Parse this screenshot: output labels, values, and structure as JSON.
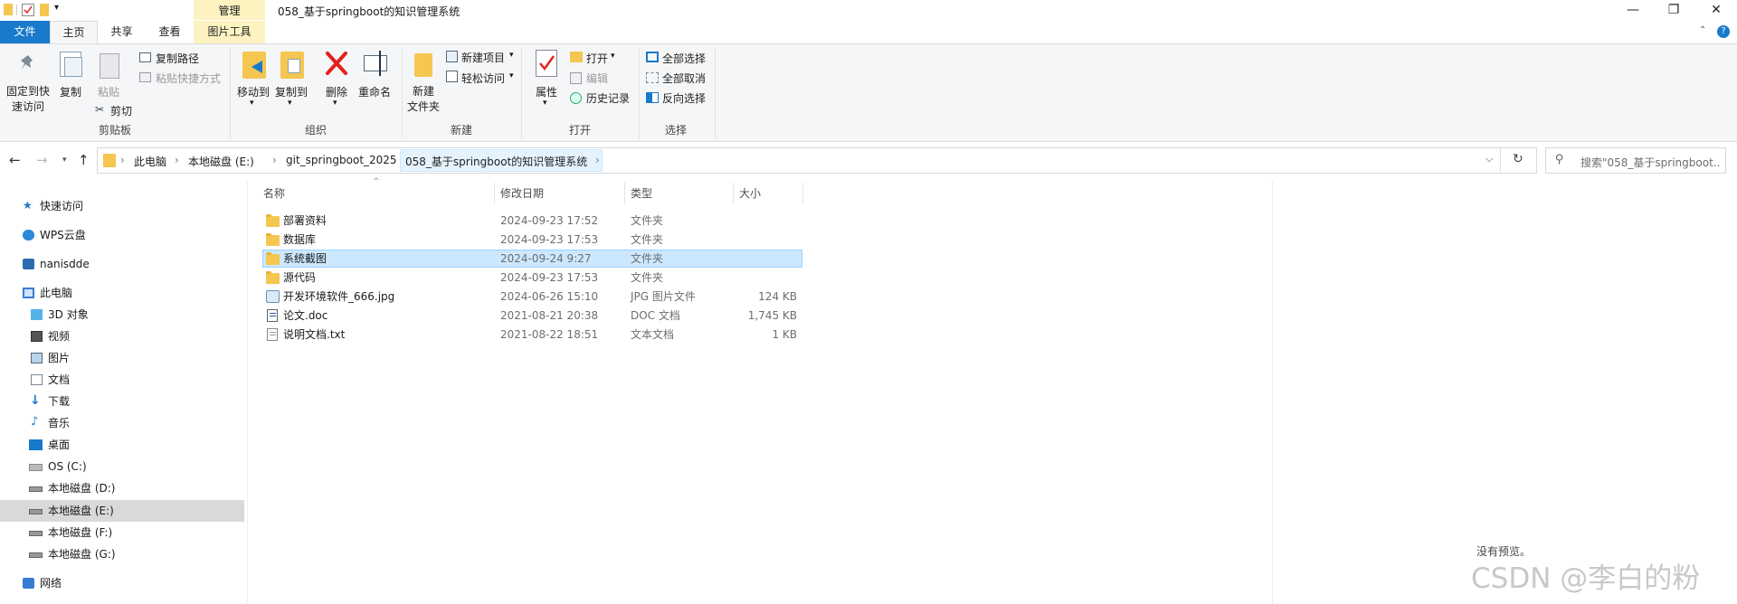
{
  "window": {
    "title": "058_基于springboot的知识管理系统",
    "context_tab_header": "管理",
    "controls": {
      "minimize": "—",
      "maximize": "❐",
      "close": "✕"
    }
  },
  "tabs": [
    "文件",
    "主页",
    "共享",
    "查看",
    "图片工具"
  ],
  "ribbon": {
    "clipboard": {
      "pin": "固定到快\n速访问",
      "copy": "复制",
      "paste": "粘贴",
      "copy_path": "复制路径",
      "paste_shortcut": "粘贴快捷方式",
      "cut": "剪切",
      "label": "剪贴板"
    },
    "organize": {
      "move_to": "移动到",
      "copy_to": "复制到",
      "delete": "删除",
      "rename": "重命名",
      "label": "组织"
    },
    "new": {
      "new_folder": "新建\n文件夹",
      "new_item": "新建项目",
      "easy_access": "轻松访问",
      "label": "新建"
    },
    "open": {
      "properties": "属性",
      "open": "打开",
      "edit": "编辑",
      "history": "历史记录",
      "label": "打开"
    },
    "select": {
      "select_all": "全部选择",
      "select_none": "全部取消",
      "invert": "反向选择",
      "label": "选择"
    }
  },
  "address": {
    "crumbs": [
      "此电脑",
      "本地磁盘 (E:)",
      "git_springboot_2025",
      "058_基于springboot的知识管理系统"
    ],
    "search_placeholder": "搜索\"058_基于springboot..."
  },
  "nav": [
    {
      "label": "快速访问",
      "icon": "star-icon",
      "level": 0
    },
    {
      "label": "WPS云盘",
      "icon": "cloud-icon",
      "level": 0
    },
    {
      "label": "nanisdde",
      "icon": "user-icon",
      "level": 0
    },
    {
      "label": "此电脑",
      "icon": "pc-icon",
      "level": 0
    },
    {
      "label": "3D 对象",
      "icon": "cube-icon",
      "level": 1
    },
    {
      "label": "视频",
      "icon": "video-icon",
      "level": 1
    },
    {
      "label": "图片",
      "icon": "picture-icon",
      "level": 1
    },
    {
      "label": "文档",
      "icon": "document-icon",
      "level": 1
    },
    {
      "label": "下载",
      "icon": "download-icon",
      "level": 1
    },
    {
      "label": "音乐",
      "icon": "music-icon",
      "level": 1
    },
    {
      "label": "桌面",
      "icon": "desktop-icon",
      "level": 1
    },
    {
      "label": "OS (C:)",
      "icon": "drive-os-icon",
      "level": 1
    },
    {
      "label": "本地磁盘 (D:)",
      "icon": "drive-icon",
      "level": 1
    },
    {
      "label": "本地磁盘 (E:)",
      "icon": "drive-icon",
      "level": 1,
      "selected": true
    },
    {
      "label": "本地磁盘 (F:)",
      "icon": "drive-icon",
      "level": 1
    },
    {
      "label": "本地磁盘 (G:)",
      "icon": "drive-icon",
      "level": 1
    },
    {
      "label": "网络",
      "icon": "network-icon",
      "level": 0
    }
  ],
  "columns": [
    "名称",
    "修改日期",
    "类型",
    "大小"
  ],
  "files": [
    {
      "name": "部署资料",
      "date": "2024-09-23 17:52",
      "type": "文件夹",
      "size": "",
      "icon": "folder-icon"
    },
    {
      "name": "数据库",
      "date": "2024-09-23 17:53",
      "type": "文件夹",
      "size": "",
      "icon": "folder-icon"
    },
    {
      "name": "系统截图",
      "date": "2024-09-24 9:27",
      "type": "文件夹",
      "size": "",
      "icon": "folder-icon",
      "selected": true
    },
    {
      "name": "源代码",
      "date": "2024-09-23 17:53",
      "type": "文件夹",
      "size": "",
      "icon": "folder-icon"
    },
    {
      "name": "开发环境软件_666.jpg",
      "date": "2024-06-26 15:10",
      "type": "JPG 图片文件",
      "size": "124 KB",
      "icon": "jpg-file-icon"
    },
    {
      "name": "论文.doc",
      "date": "2021-08-21 20:38",
      "type": "DOC 文档",
      "size": "1,745 KB",
      "icon": "doc-file-icon"
    },
    {
      "name": "说明文档.txt",
      "date": "2021-08-22 18:51",
      "type": "文本文档",
      "size": "1 KB",
      "icon": "txt-file-icon"
    }
  ],
  "preview": {
    "text": "没有预览。"
  },
  "watermark": "CSDN @李白的粉",
  "colors": {
    "selection": "#cce8ff",
    "selection_border": "#99d1ff",
    "file_tab": "#1979ca",
    "context_tab": "#fcf3c1"
  }
}
